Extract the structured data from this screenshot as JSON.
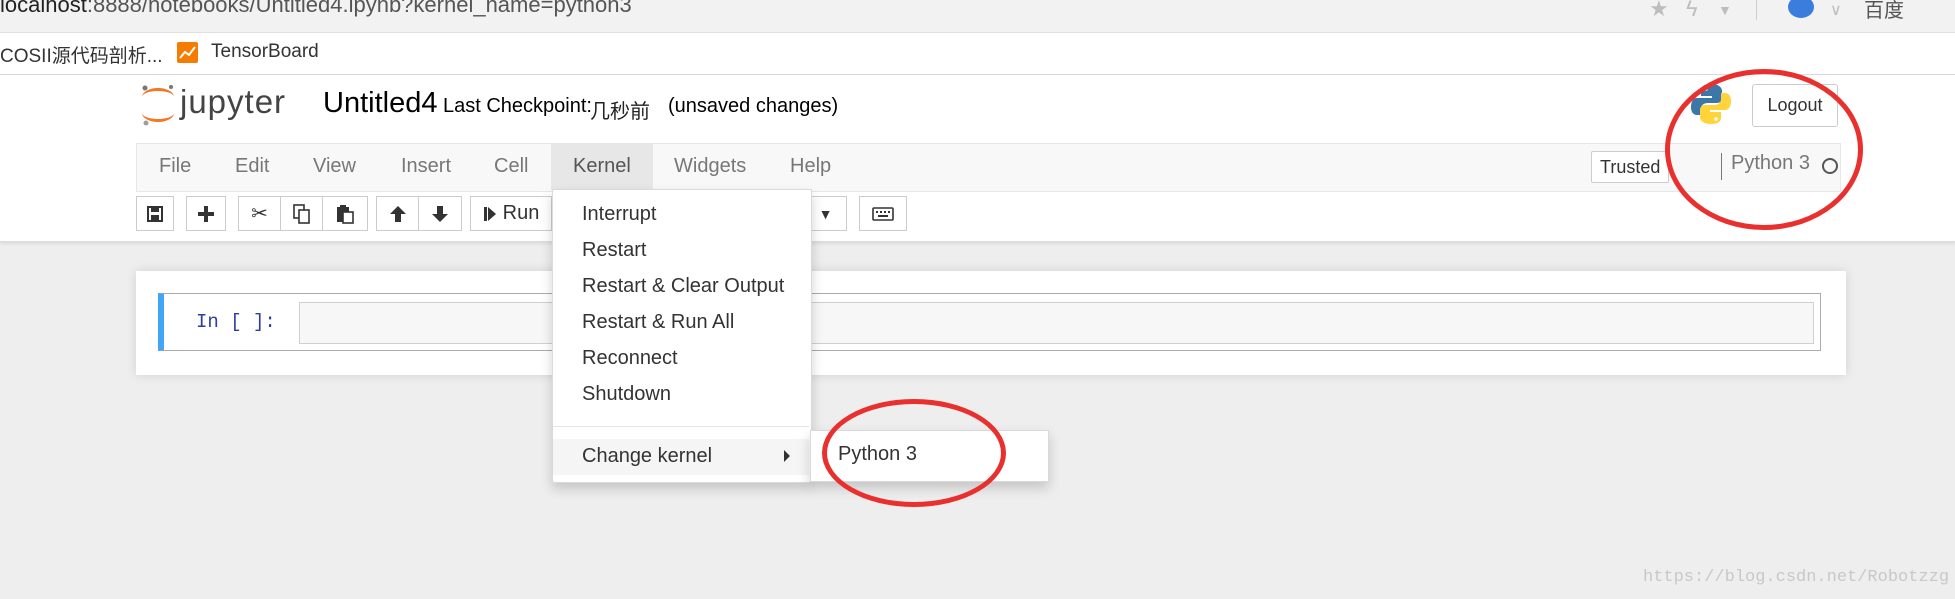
{
  "browser": {
    "url_host": "localhost",
    "url_rest": ":8888/notebooks/Untitled4.ipynb?kernel_name=python3",
    "search_label": "百度",
    "bookmarks": [
      "COSII源代码剖析...",
      "TensorBoard"
    ]
  },
  "header": {
    "logo_text": "jupyter",
    "notebook_name": "Untitled4",
    "checkpoint_label": "Last Checkpoint:",
    "checkpoint_time": "几秒前",
    "unsaved": "(unsaved changes)",
    "logout_label": "Logout"
  },
  "menubar": {
    "items": [
      "File",
      "Edit",
      "View",
      "Insert",
      "Cell",
      "Kernel",
      "Widgets",
      "Help"
    ],
    "active": "Kernel",
    "trusted_label": "Trusted",
    "kernel_name": "Python 3"
  },
  "toolbar": {
    "run_label": "Run",
    "icons": [
      "save-icon",
      "plus-icon",
      "scissors-icon",
      "copy-icon",
      "paste-icon",
      "arrow-up-icon",
      "arrow-down-icon",
      "step-forward-icon",
      "keyboard-icon"
    ]
  },
  "cell": {
    "prompt": "In [ ]:"
  },
  "kernel_menu": {
    "items": [
      "Interrupt",
      "Restart",
      "Restart & Clear Output",
      "Restart & Run All",
      "Reconnect",
      "Shutdown"
    ],
    "change_kernel": "Change kernel",
    "submenu_items": [
      "Python 3"
    ]
  },
  "colors": {
    "annotation_red": "#e8312e",
    "cell_selected_border": "#42a5f5",
    "jupyter_orange": "#f37726"
  },
  "watermark": "https://blog.csdn.net/Robotzzg"
}
